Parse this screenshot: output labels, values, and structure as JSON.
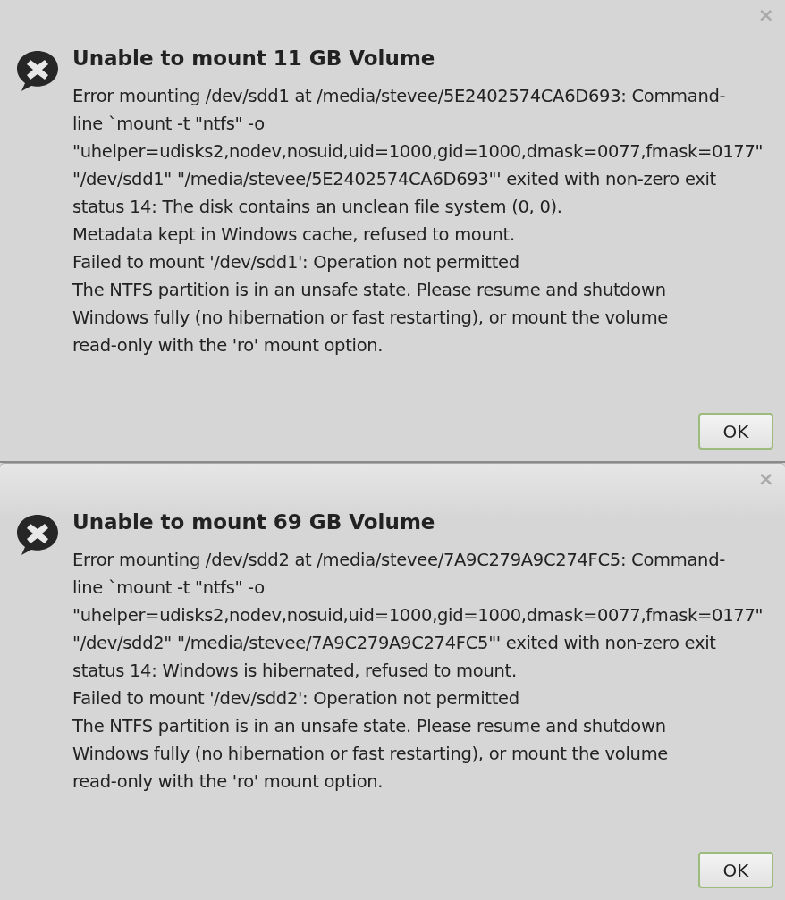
{
  "dialogs": [
    {
      "close": "×",
      "title": "Unable to mount 11 GB Volume",
      "message": "Error mounting /dev/sdd1 at /media/stevee/5E2402574CA6D693: Command-\nline `mount -t \"ntfs\" -o\n\"uhelper=udisks2,nodev,nosuid,uid=1000,gid=1000,dmask=0077,fmask=0177\"\n\"/dev/sdd1\" \"/media/stevee/5E2402574CA6D693\"' exited with non-zero exit\nstatus 14: The disk contains an unclean file system (0, 0).\nMetadata kept in Windows cache, refused to mount.\nFailed to mount '/dev/sdd1': Operation not permitted\nThe NTFS partition is in an unsafe state. Please resume and shutdown\nWindows fully (no hibernation or fast restarting), or mount the volume\nread-only with the 'ro' mount option.",
      "button": "OK"
    },
    {
      "close": "×",
      "title": "Unable to mount 69 GB Volume",
      "message": "Error mounting /dev/sdd2 at /media/stevee/7A9C279A9C274FC5: Command-\nline `mount -t \"ntfs\" -o\n\"uhelper=udisks2,nodev,nosuid,uid=1000,gid=1000,dmask=0077,fmask=0177\"\n\"/dev/sdd2\" \"/media/stevee/7A9C279A9C274FC5\"' exited with non-zero exit\nstatus 14: Windows is hibernated, refused to mount.\nFailed to mount '/dev/sdd2': Operation not permitted\nThe NTFS partition is in an unsafe state. Please resume and shutdown\nWindows fully (no hibernation or fast restarting), or mount the volume\nread-only with the 'ro' mount option.",
      "button": "OK"
    }
  ]
}
